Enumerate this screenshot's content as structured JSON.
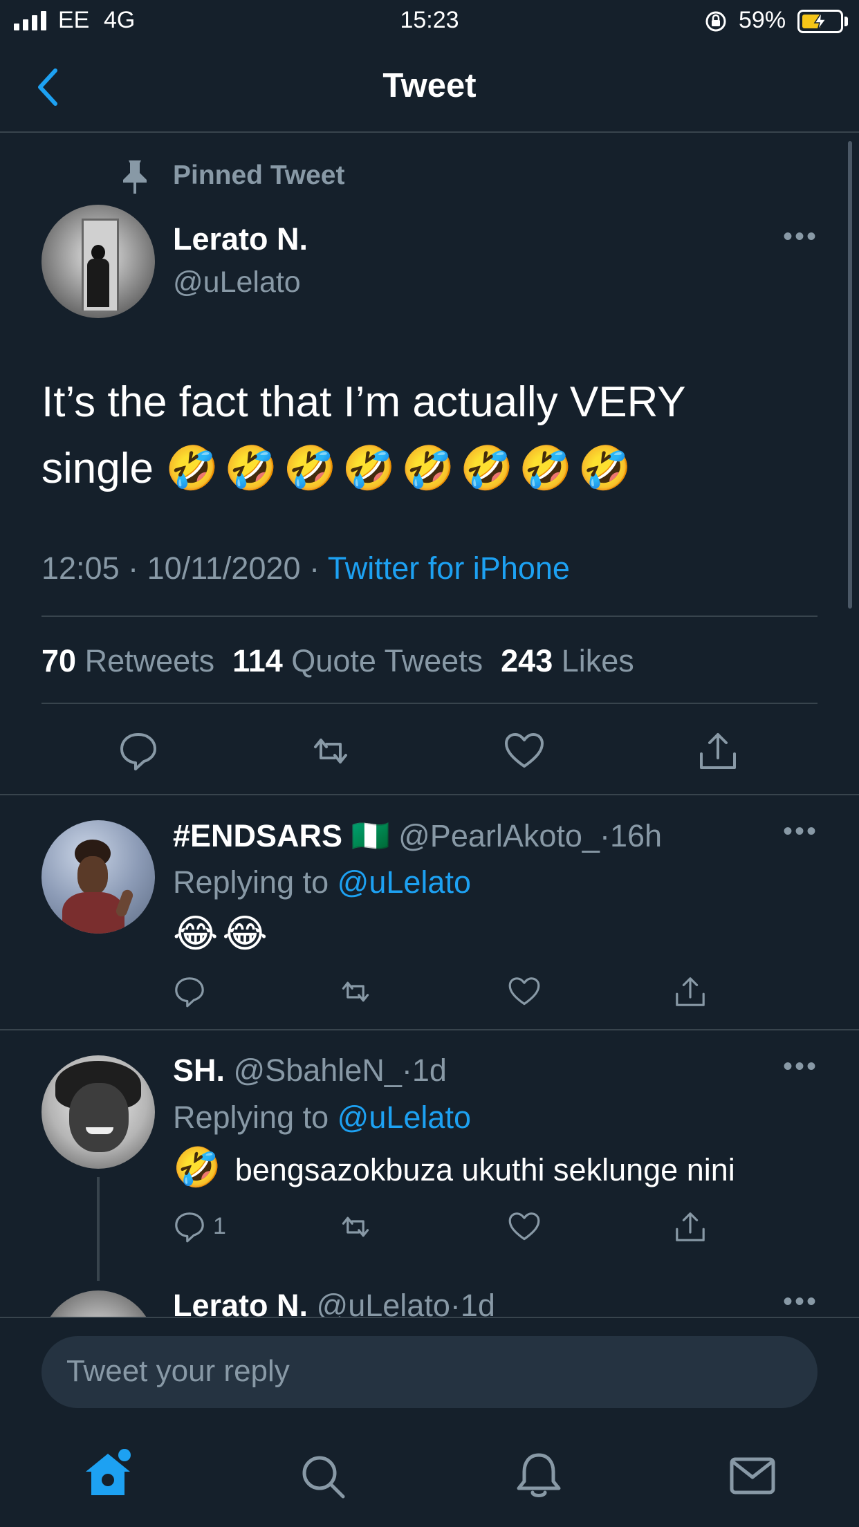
{
  "status_bar": {
    "carrier": "EE",
    "network": "4G",
    "time": "15:23",
    "battery": "59%",
    "battery_level": 0.59
  },
  "header": {
    "title": "Tweet"
  },
  "main_tweet": {
    "pinned_label": "Pinned Tweet",
    "author_name": "Lerato N.",
    "author_handle": "@uLelato",
    "text": "It’s the fact that I’m actually VERY single",
    "emojis": "🤣🤣🤣🤣🤣🤣🤣🤣",
    "time": "12:05",
    "date": "10/11/2020",
    "source": "Twitter for iPhone",
    "stats": {
      "retweets": "70",
      "retweets_label": "Retweets",
      "quotes": "114",
      "quotes_label": "Quote Tweets",
      "likes": "243",
      "likes_label": "Likes"
    }
  },
  "replies": [
    {
      "name": "#ENDSARS",
      "flag": "🇳🇬",
      "handle": "@PearlAkoto_",
      "time": "16h",
      "replying_label": "Replying to",
      "replying_to": "@uLelato",
      "text": "😂😂",
      "reply_count": ""
    },
    {
      "name": "SH.",
      "handle": "@SbahleN_",
      "time": "1d",
      "replying_label": "Replying to",
      "replying_to": "@uLelato",
      "emoji": "🤣",
      "text": "bengsazokbuza ukuthi seklunge nini",
      "reply_count": "1"
    },
    {
      "name": "Lerato N.",
      "handle": "@uLelato",
      "time": "1d"
    }
  ],
  "reply_input": {
    "placeholder": "Tweet your reply"
  },
  "separator": "·"
}
